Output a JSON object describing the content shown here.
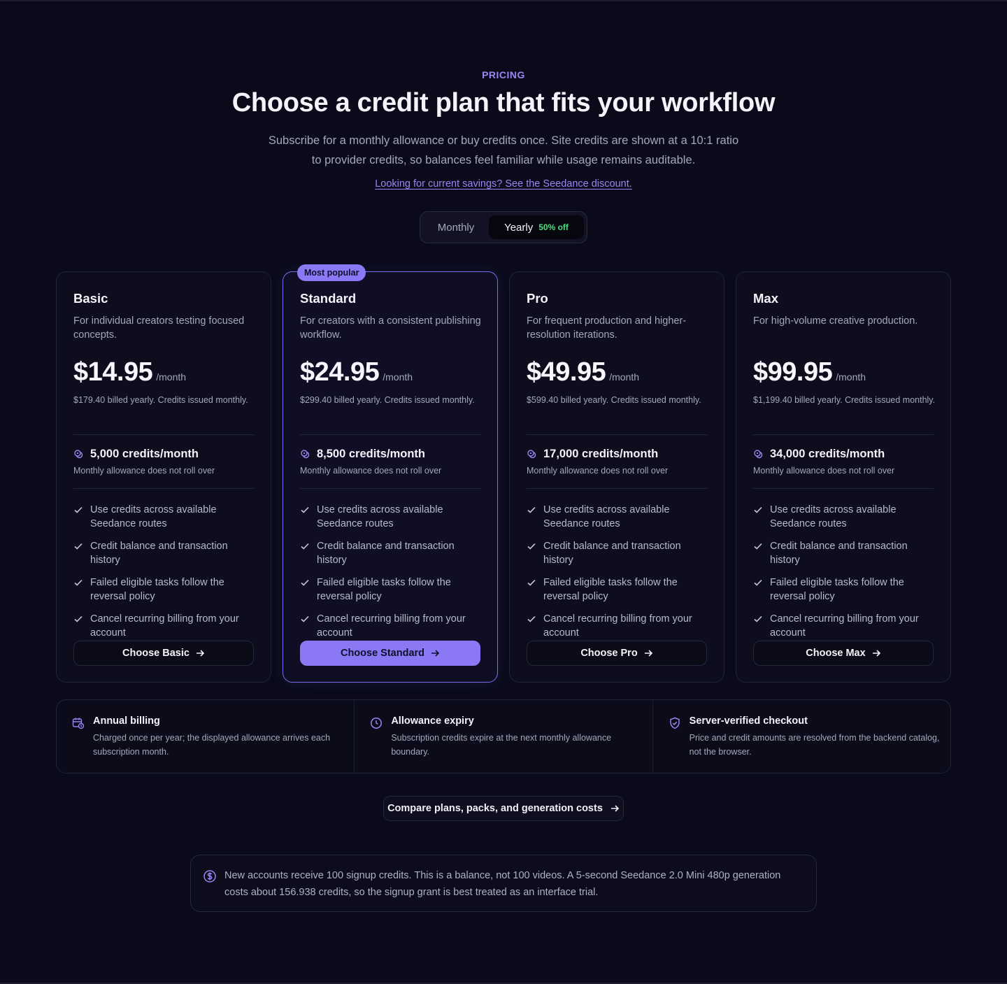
{
  "header": {
    "eyebrow": "PRICING",
    "title": "Choose a credit plan that fits your workflow",
    "subtitle": "Subscribe for a monthly allowance or buy credits once. Site credits are shown at a 10:1 ratio to provider credits, so balances feel familiar while usage remains auditable.",
    "discount_link": "Looking for current savings? See the Seedance discount."
  },
  "billing_toggle": {
    "monthly_label": "Monthly",
    "yearly_label": "Yearly",
    "yearly_badge": "50% off",
    "selected": "Yearly"
  },
  "plans": [
    {
      "name": "Basic",
      "description": "For individual creators testing focused concepts.",
      "price": "$14.95",
      "period": "/month",
      "billed_note": "$179.40 billed yearly. Credits issued monthly.",
      "credits": "5,000 credits/month",
      "rollover": "Monthly allowance does not roll over",
      "features": [
        "Use credits across available Seedance routes",
        "Credit balance and transaction history",
        "Failed eligible tasks follow the reversal policy",
        "Cancel recurring billing from your account"
      ],
      "cta": "Choose Basic"
    },
    {
      "name": "Standard",
      "badge": "Most popular",
      "description": "For creators with a consistent publishing workflow.",
      "price": "$24.95",
      "period": "/month",
      "billed_note": "$299.40 billed yearly. Credits issued monthly.",
      "credits": "8,500 credits/month",
      "rollover": "Monthly allowance does not roll over",
      "features": [
        "Use credits across available Seedance routes",
        "Credit balance and transaction history",
        "Failed eligible tasks follow the reversal policy",
        "Cancel recurring billing from your account"
      ],
      "cta": "Choose Standard"
    },
    {
      "name": "Pro",
      "description": "For frequent production and higher-resolution iterations.",
      "price": "$49.95",
      "period": "/month",
      "billed_note": "$599.40 billed yearly. Credits issued monthly.",
      "credits": "17,000 credits/month",
      "rollover": "Monthly allowance does not roll over",
      "features": [
        "Use credits across available Seedance routes",
        "Credit balance and transaction history",
        "Failed eligible tasks follow the reversal policy",
        "Cancel recurring billing from your account"
      ],
      "cta": "Choose Pro"
    },
    {
      "name": "Max",
      "description": "For high-volume creative production.",
      "price": "$99.95",
      "period": "/month",
      "billed_note": "$1,199.40 billed yearly. Credits issued monthly.",
      "credits": "34,000 credits/month",
      "rollover": "Monthly allowance does not roll over",
      "features": [
        "Use credits across available Seedance routes",
        "Credit balance and transaction history",
        "Failed eligible tasks follow the reversal policy",
        "Cancel recurring billing from your account"
      ],
      "cta": "Choose Max"
    }
  ],
  "info": [
    {
      "icon": "calendar-clock-icon",
      "title": "Annual billing",
      "text": "Charged once per year; the displayed allowance arrives each subscription month."
    },
    {
      "icon": "clock-icon",
      "title": "Allowance expiry",
      "text": "Subscription credits expire at the next monthly allowance boundary."
    },
    {
      "icon": "shield-check-icon",
      "title": "Server-verified checkout",
      "text": "Price and credit amounts are resolved from the backend catalog, not the browser."
    }
  ],
  "compare_link": "Compare plans, packs, and generation costs",
  "notice": {
    "icon": "dollar-circle-icon",
    "text": "New accounts receive 100 signup credits. This is a balance, not 100 videos. A 5-second Seedance 2.0 Mini 480p generation costs about 156.938 credits, so the signup grant is best treated as an interface trial."
  },
  "colors": {
    "background": "#0a0a1a",
    "accent": "#8b78f5",
    "badge_green": "#4ade80"
  }
}
